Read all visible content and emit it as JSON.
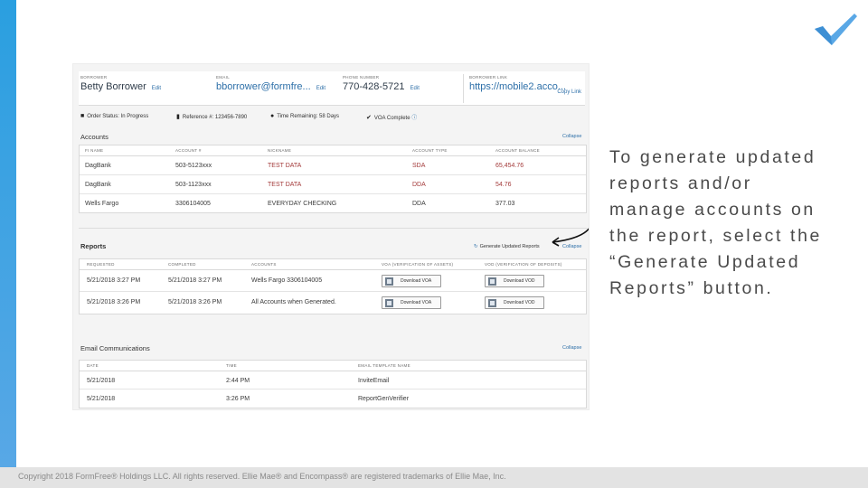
{
  "colors": {
    "accent": "#2a9fe0",
    "link": "#2d6fa8"
  },
  "instruction": "To generate updated reports and/or manage accounts on the report,  select the “Generate Updated Reports” button.",
  "footer": "Copyright 2018 FormFree® Holdings LLC. All rights reserved. Ellie Mae® and Encompass® are registered trademarks of Ellie Mae, Inc.",
  "borrower": {
    "name_label": "Borrower",
    "name": "Betty Borrower",
    "email_label": "Email",
    "email": "bborrower@formfre...",
    "phone_label": "Phone Number",
    "phone": "770-428-5721",
    "link_label": "Borrower Link",
    "link": "https://mobile2.acco...",
    "edit_label": "Edit",
    "copy_link": "Copy Link"
  },
  "status": {
    "order": "Order Status: In Progress",
    "reference": "Reference #: 123456-7890",
    "time": "Time Remaining: 58 Days",
    "voa": "VOA Complete"
  },
  "accounts": {
    "title": "Accounts",
    "collapse": "Collapse",
    "headers": [
      "FI Name",
      "Account #",
      "Nickname",
      "Account Type",
      "Account Balance"
    ],
    "rows": [
      [
        "DagBank",
        "503-5123xxx",
        "TEST DATA",
        "SDA",
        "65,454.76"
      ],
      [
        "DagBank",
        "503-1123xxx",
        "TEST DATA",
        "DDA",
        "54.76"
      ],
      [
        "Wells Fargo",
        "3306104005",
        "EVERYDAY CHECKING",
        "DDA",
        "377.03"
      ]
    ]
  },
  "reports": {
    "title": "Reports",
    "generate": "Generate Updated Reports",
    "collapse": "Collapse",
    "headers": [
      "Requested",
      "Completed",
      "Accounts",
      "VOA (Verification of Assets)",
      "VOD (Verification of Deposits)"
    ],
    "rows": [
      {
        "requested": "5/21/2018 3:27 PM",
        "completed": "5/21/2018 3:27 PM",
        "accounts": "Wells Fargo 3306104005",
        "voa": "Download VOA",
        "vod": "Download VOD"
      },
      {
        "requested": "5/21/2018 3:26 PM",
        "completed": "5/21/2018 3:26 PM",
        "accounts": "All Accounts when Generated.",
        "voa": "Download VOA",
        "vod": "Download VOD"
      }
    ]
  },
  "emails": {
    "title": "Email Communications",
    "collapse": "Collapse",
    "headers": [
      "Date",
      "Time",
      "Email Template Name"
    ],
    "rows": [
      [
        "5/21/2018",
        "2:44 PM",
        "InviteEmail"
      ],
      [
        "5/21/2018",
        "3:26 PM",
        "ReportGenVerifier"
      ]
    ]
  }
}
